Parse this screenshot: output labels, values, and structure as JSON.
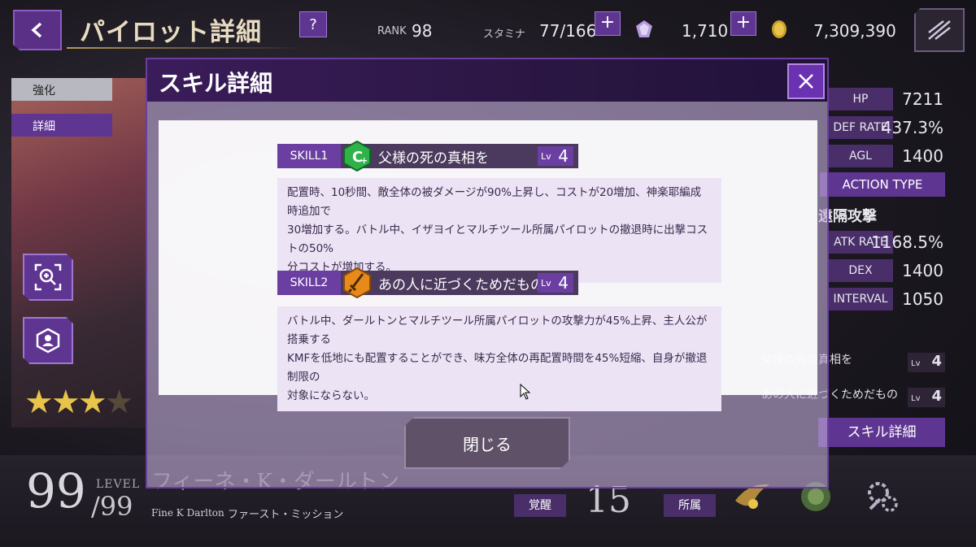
{
  "topbar": {
    "title": "パイロット詳細",
    "help": "?",
    "rank_label": "RANK",
    "rank_value": "98",
    "stamina_label": "スタミナ",
    "stamina_value": "77/166",
    "gem_value": "1,710",
    "coin_value": "7,309,390",
    "plus": "+"
  },
  "left": {
    "tab_strengthen": "強化",
    "tab_details": "詳細",
    "stars_filled": 3,
    "stars_total": 4
  },
  "bottom": {
    "level": "99",
    "level_label": "LEVEL",
    "level_max": "/99",
    "pilot_name": "フィーネ・K・ダールトン",
    "pilot_name_en": "Fine K Darlton",
    "mission": "ファースト・ミッション",
    "awaken_label": "覚醒",
    "awaken_value": "15",
    "belong_label": "所属"
  },
  "stats": {
    "hp_label": "HP",
    "hp": "7211",
    "def_label": "DEF RATE",
    "def": "437.3%",
    "agl_label": "AGL",
    "agl": "1400",
    "action_type": "ACTION TYPE",
    "attack_kind": "遠隔攻撃",
    "atk_label": "ATK RATE",
    "atk": "1168.5%",
    "dex_label": "DEX",
    "dex": "1400",
    "interval_label": "INTERVAL",
    "interval": "1050",
    "skill_list": [
      {
        "name": "父様の死の真相を",
        "lv": "4"
      },
      {
        "name": "あの人に近づくためだもの",
        "lv": "4"
      }
    ],
    "skill_detail_button": "スキル詳細"
  },
  "modal": {
    "title": "スキル詳細",
    "close_button": "閉じる",
    "lv_abbr": "Lv",
    "skills": [
      {
        "tag": "SKILL1",
        "name": "父様の死の真相を",
        "lv": "4",
        "description_lines": [
          "配置時、10秒間、敵全体の被ダメージが90%上昇し、コストが20増加、神楽耶編成時追加で",
          "30増加する。バトル中、イザヨイとマルチツール所属パイロットの撤退時に出撃コストの50%",
          "分コストが増加する。"
        ]
      },
      {
        "tag": "SKILL2",
        "name": "あの人に近づくためだもの",
        "lv": "4",
        "description_lines": [
          "バトル中、ダールトンとマルチツール所属パイロットの攻撃力が45%上昇、主人公が搭乗する",
          "KMFを低地にも配置することができ、味方全体の再配置時間を45%短縮、自身が撤退制限の",
          "対象にならない。"
        ]
      }
    ]
  },
  "icons": {
    "back": "chevron-left-icon",
    "close": "close-x-icon",
    "skill1": "c-plus-hexagon-icon",
    "skill2": "sword-hexagon-icon",
    "gem": "gem-icon",
    "coin": "coin-icon"
  },
  "colors": {
    "accent_purple": "#5f3592",
    "modal_header": "#2a1642",
    "skill1_icon": "#2fb24a",
    "skill2_icon": "#e88a1a",
    "gold": "#e8c44a"
  }
}
